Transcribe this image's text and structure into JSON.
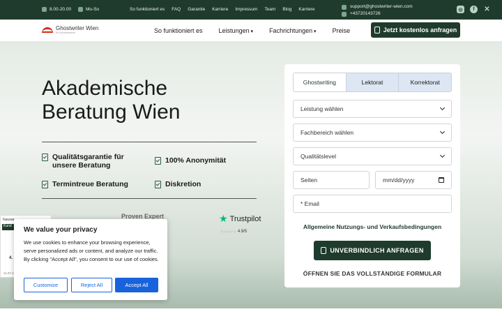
{
  "topbar": {
    "hours": "8.00-20.00",
    "days": "Mo-So",
    "nav": [
      "So funktioniert es",
      "FAQ",
      "Garantie",
      "Karriere",
      "Impressum",
      "Team",
      "Blog",
      "Karriere"
    ],
    "email": "support@ghostwriter-wien.com",
    "phone": "+43720143726",
    "social": [
      "instagram-icon",
      "facebook-icon",
      "x-twitter-icon"
    ]
  },
  "header": {
    "logo_text": "Ghostwriter Wien",
    "logo_sub": "Ihr Schreibpartner",
    "nav": [
      {
        "label": "So funktioniert es",
        "dropdown": false
      },
      {
        "label": "Leistungen",
        "dropdown": true
      },
      {
        "label": "Fachrichtungen",
        "dropdown": true
      },
      {
        "label": "Preise",
        "dropdown": false
      }
    ],
    "cta": "Jetzt kostenlos anfragen"
  },
  "hero": {
    "title_line1": "Akademische",
    "title_line2": "Beratung Wien",
    "features": [
      "Qualitätsgarantie für unsere Beratung",
      "100% Anonymität",
      "Termintreue Beratung",
      "Diskretion"
    ],
    "partners": {
      "proven_expert": "Proven Expert",
      "trustpilot": "Trustpilot",
      "trustpilot_rating": "4.9/5"
    }
  },
  "form": {
    "tabs": [
      "Ghostwriting",
      "Lektorat",
      "Korrektorat"
    ],
    "active_tab": "Ghostwriting",
    "service_placeholder": "Leistung wählen",
    "field_placeholder": "Fachbereich wählen",
    "level_placeholder": "Qualitätslevel",
    "pages_placeholder": "Seiten",
    "date_placeholder": "mm/dd/yyyy",
    "email_placeholder": "* Email",
    "terms": "Allgemeine Nutzungs- und Verkaufsbedingungen",
    "submit": "UNVERBINDLICH ANFRAGEN",
    "full_form": "ÖFFNEN SIE DAS VOLLSTÄNDIGE FORMULAR"
  },
  "widget": {
    "head": "hausar",
    "bar": "Kund",
    "score": "4.",
    "date": "11.07.2"
  },
  "cookie": {
    "title": "We value your privacy",
    "body": "We use cookies to enhance your browsing experience, serve personalized ads or content, and analyze our traffic. By clicking \"Accept All\", you consent to our use of cookies.",
    "customize": "Customize",
    "reject": "Reject All",
    "accept": "Accept All"
  },
  "colors": {
    "brand_green": "#1f3b2d",
    "cookie_blue": "#1863dc",
    "trustpilot_green": "#00b67a",
    "logo_red": "#d4281f"
  }
}
